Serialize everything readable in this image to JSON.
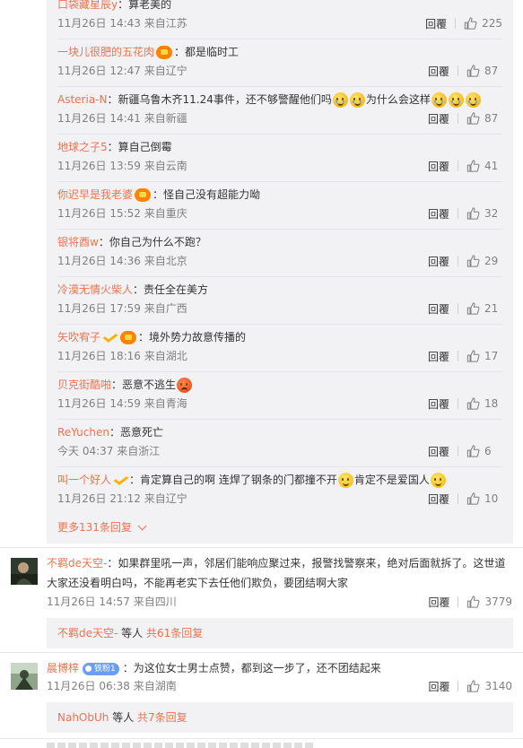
{
  "actions": {
    "reply_label": "回覆"
  },
  "replies": [
    {
      "name": "口袋藏星辰y",
      "text": "：算老美的",
      "time": "11月26日 14:43 来自江苏",
      "likes": "225",
      "badges": []
    },
    {
      "name": "一块儿很肥的五花肉",
      "text": "：都是临时工",
      "time": "11月26日 12:47 来自辽宁",
      "likes": "87",
      "badges": [
        "vip-icon"
      ]
    },
    {
      "name": "Asteria-N",
      "text": "：新疆乌鲁木齐11.24事件，还不够警醒他们吗",
      "text2": "为什么会这样",
      "time": "11月26日 14:41 来自新疆",
      "likes": "87",
      "badges": []
    },
    {
      "name": "地球之子5",
      "text": "：算自己倒霉",
      "time": "11月26日 13:59 来自云南",
      "likes": "41",
      "badges": []
    },
    {
      "name": "你迟早是我老婆",
      "text": "：怪自己没有超能力呦",
      "time": "11月26日 15:52 来自重庆",
      "likes": "32",
      "badges": [
        "vip-icon"
      ]
    },
    {
      "name": "银将酉w",
      "text": "：你自己为什么不跑？",
      "time": "11月26日 14:36 来自北京",
      "likes": "29",
      "badges": []
    },
    {
      "name": "冷漠无情火柴人",
      "text": "：责任全在美方",
      "time": "11月26日 17:59 来自广西",
      "likes": "21",
      "badges": []
    },
    {
      "name": "矢吹宥子",
      "text": "：境外势力故意传播的",
      "time": "11月26日 18:16 来自湖北",
      "likes": "17",
      "badges": [
        "verified-v-icon",
        "vip-icon"
      ]
    },
    {
      "name": "贝克街酷啪",
      "text": "：恶意不逃生",
      "time": "11月26日 14:59 来自青海",
      "likes": "18",
      "badges": []
    },
    {
      "name": "ReYuchen",
      "text": "：恶意死亡",
      "time": "今天 04:37 来自浙江",
      "likes": "6",
      "badges": []
    },
    {
      "name": "叫一个好人",
      "text": "：肯定算自己的啊 连焊了钢条的门都撞不开",
      "text2": "肯定不是爱国人",
      "time": "11月26日 21:12 来自辽宁",
      "likes": "10",
      "badges": [
        "verified-v-icon"
      ]
    }
  ],
  "more_replies": "更多131条回复",
  "comments": [
    {
      "name": "不羁de天空-",
      "text": "：如果群里吼一声，邻居们能响应聚过来，报警找警察来，绝对后面就拆了。这世道大家还没看明白吗，不能再老实下去任他们欺负，要团结啊大家",
      "time": "11月26日 14:57 来自四川",
      "likes": "3779",
      "summary_name": "不羁de天空-",
      "summary_mid": " 等人 ",
      "summary_total": "共61条回复"
    },
    {
      "name": "晨博梓",
      "badge": "铁粉1",
      "text": "：为这位女士男士点赞，都到这一步了，还不团结起来",
      "time": "11月26日 06:38 来自湖南",
      "likes": "3140",
      "summary_name": "NahObUh",
      "summary_mid": " 等人 ",
      "summary_total": "共7条回复"
    }
  ],
  "colors": {
    "accent": "#eb7350",
    "reply_bg": "#f2f2f5",
    "muted": "#808080"
  }
}
